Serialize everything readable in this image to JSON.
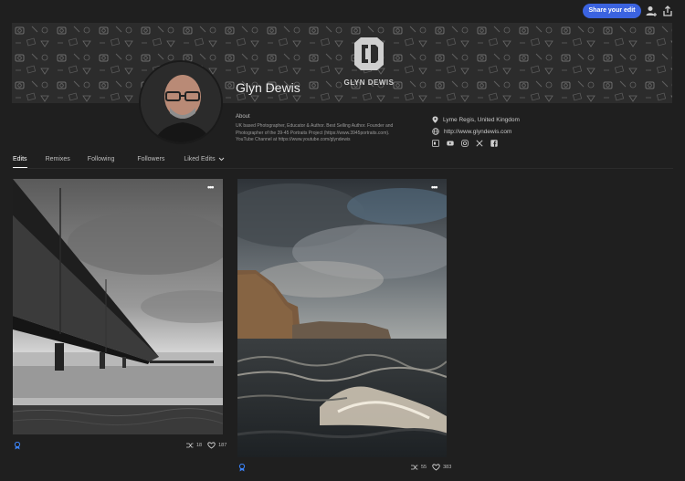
{
  "topbar": {
    "share_label": "Share your edit"
  },
  "banner": {
    "logo_text": "GLYN DEWIS"
  },
  "profile": {
    "name": "Glyn Dewis",
    "about_label": "About",
    "about_lines": [
      "UK based Photographer, Educator & Author. Best Selling Author. Founder and",
      "Photographer of the 39-45 Portraits Project (https://www.3945portraits.com).",
      "YouTube Channel at https://www.youtube.com/glyndewis"
    ],
    "location": "Lyme Regis, United Kingdom",
    "website": "http://www.glyndewis.com"
  },
  "tabs": [
    "Edits",
    "Remixes",
    "Following",
    "Followers",
    "Liked Edits"
  ],
  "cards": [
    {
      "remixes": "18",
      "likes": "187"
    },
    {
      "remixes": "55",
      "likes": "383"
    }
  ],
  "icons": [
    "share-upload-icon",
    "add-user-icon",
    "location-pin-icon",
    "globe-icon",
    "behance-icon",
    "youtube-icon",
    "instagram-icon",
    "x-icon",
    "facebook-icon",
    "more-icon",
    "remix-icon",
    "heart-icon",
    "badge-icon",
    "chevron-down-icon"
  ]
}
